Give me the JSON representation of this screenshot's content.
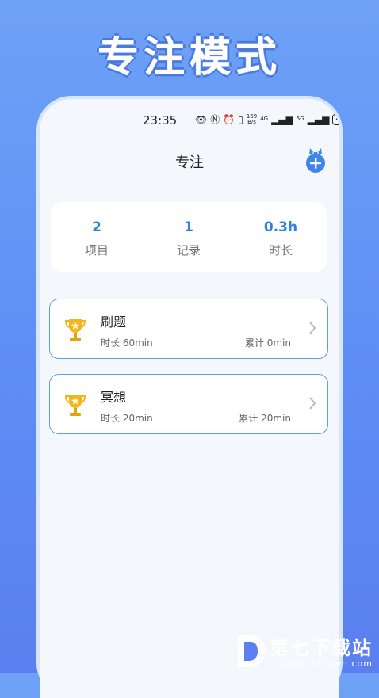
{
  "headline": "专注模式",
  "status_bar": {
    "time": "23:35",
    "net_speed_top": "169",
    "net_speed_bottom": "B/s",
    "signal1": "4G",
    "signal2": "5G",
    "battery": "42"
  },
  "header": {
    "title": "专注"
  },
  "stats": [
    {
      "value": "2",
      "label": "项目"
    },
    {
      "value": "1",
      "label": "记录"
    },
    {
      "value": "0.3h",
      "label": "时长"
    }
  ],
  "tasks": [
    {
      "name": "刷题",
      "duration": "时长 60min",
      "total": "累计 0min"
    },
    {
      "name": "冥想",
      "duration": "时长 20min",
      "total": "累计 20min"
    }
  ],
  "watermark": {
    "main": "第七下载站",
    "sub": "www.d7down.com"
  },
  "colors": {
    "accent": "#2f7fe6",
    "card_border": "#5b9ef0",
    "trophy": "#f2b51d"
  }
}
